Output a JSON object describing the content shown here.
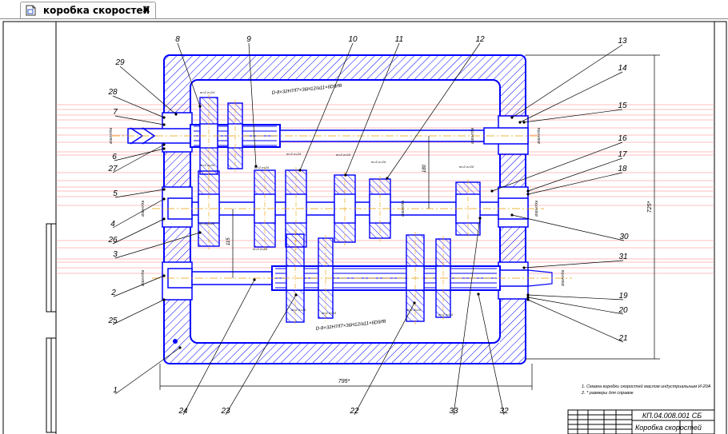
{
  "tab": {
    "title": "коробка скоростей",
    "close_glyph": "×"
  },
  "drawing": {
    "doc_code": "КП.04.008.001 СБ",
    "doc_name": "Коробка скоростей",
    "notes": [
      "1. Смазка коробки скоростей маслом индустриальным И-20А",
      "2. * размеры для справок"
    ],
    "fit_top": "D-8×32H7/f7×36H12/a11×6D9/f8",
    "fit_bottom": "D-8×32H7/f7×36H12/a11×6D9/f8",
    "dim_width": "795*",
    "dim_height": "725*",
    "dim_axis": "180",
    "dim_axis2": "115",
    "fit_label": "Ø40H7/k6",
    "gear_label": "m=2 z=24",
    "callouts_left": [
      "29",
      "28",
      "7",
      "6",
      "27",
      "5",
      "4",
      "26",
      "3",
      "2",
      "25",
      "1"
    ],
    "callouts_top": [
      "8",
      "9",
      "10",
      "11",
      "12"
    ],
    "callouts_right": [
      "13",
      "14",
      "15",
      "16",
      "17",
      "18",
      "30",
      "31",
      "19",
      "20",
      "21"
    ],
    "callouts_bottom": [
      "24",
      "23",
      "22",
      "33",
      "32"
    ]
  },
  "colors": {
    "line": "#0000ff",
    "hatch": "#0000ff",
    "axis": "#ff7f7f",
    "frame": "#000000",
    "center": "#e8a000"
  }
}
